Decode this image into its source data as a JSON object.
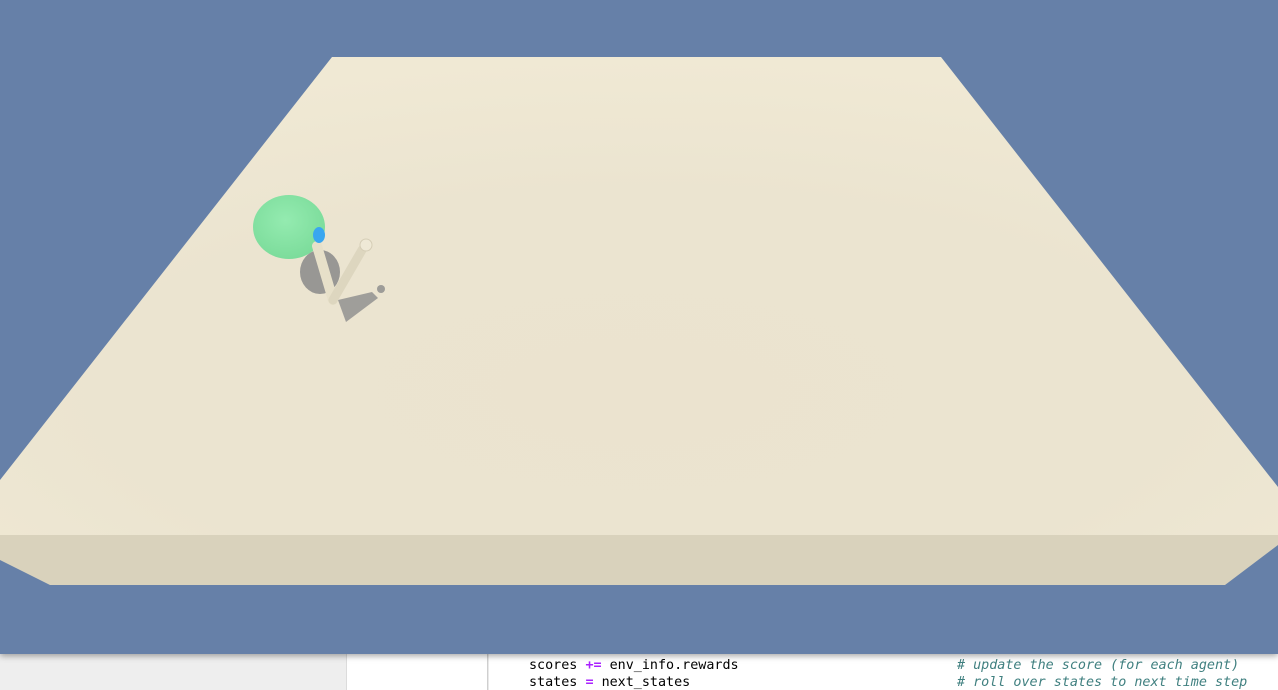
{
  "simulation": {
    "background_color": "#6680a8",
    "floor_color": "#ebe4cf",
    "floor_edge_color": "#d9d1bc",
    "target_color": "#8ce6a8",
    "hand_color": "#39a6f0",
    "arm_color": "#ece6cf"
  },
  "notebook": {
    "code_lines": [
      {
        "var": "scores",
        "op": "+=",
        "expr": "env_info.rewards",
        "comment": "# update the score (for each agent)"
      },
      {
        "var": "states",
        "op": "=",
        "expr": "next_states",
        "comment": "# roll over states to next time step"
      }
    ]
  }
}
